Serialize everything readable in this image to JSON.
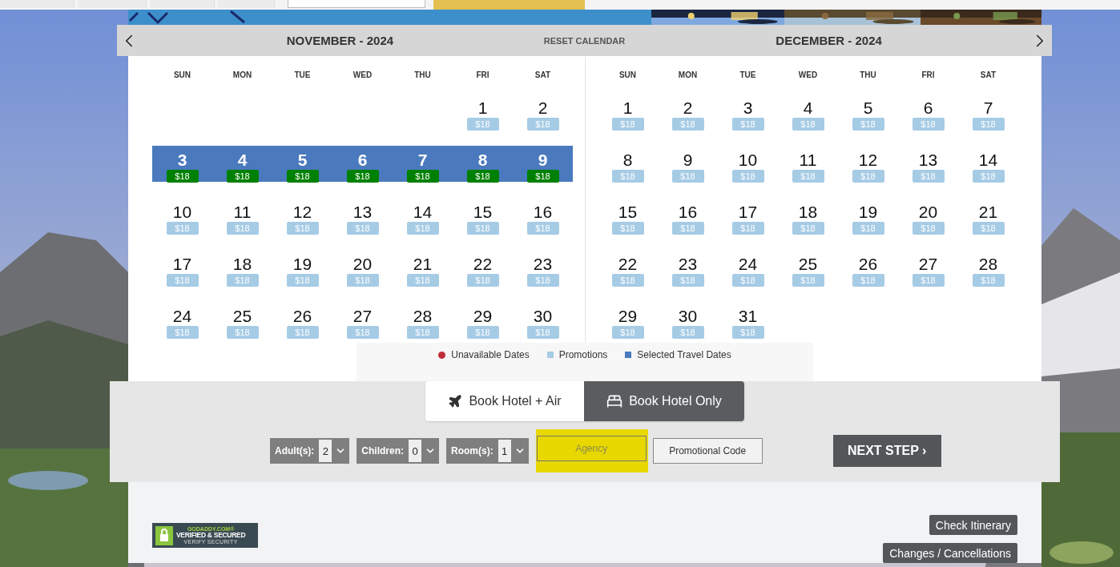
{
  "calendar": {
    "reset_label": "RESET CALENDAR",
    "months": [
      {
        "title": "NOVEMBER - 2024",
        "weekdays": [
          "SUN",
          "MON",
          "TUE",
          "WED",
          "THU",
          "FRI",
          "SAT"
        ],
        "weeks": [
          {
            "kind": "partial",
            "days": [
              {
                "day": "1",
                "price": "$18",
                "selected": false
              },
              {
                "day": "2",
                "price": "$18",
                "selected": false
              }
            ]
          },
          [
            {
              "day": "3",
              "price": "$18",
              "selected": true
            },
            {
              "day": "4",
              "price": "$18",
              "selected": true
            },
            {
              "day": "5",
              "price": "$18",
              "selected": true
            },
            {
              "day": "6",
              "price": "$18",
              "selected": true
            },
            {
              "day": "7",
              "price": "$18",
              "selected": true
            },
            {
              "day": "8",
              "price": "$18",
              "selected": true
            },
            {
              "day": "9",
              "price": "$18",
              "selected": true
            }
          ],
          [
            {
              "day": "10",
              "price": "$18",
              "selected": false
            },
            {
              "day": "11",
              "price": "$18",
              "selected": false
            },
            {
              "day": "12",
              "price": "$18",
              "selected": false
            },
            {
              "day": "13",
              "price": "$18",
              "selected": false
            },
            {
              "day": "14",
              "price": "$18",
              "selected": false
            },
            {
              "day": "15",
              "price": "$18",
              "selected": false
            },
            {
              "day": "16",
              "price": "$18",
              "selected": false
            }
          ],
          [
            {
              "day": "17",
              "price": "$18",
              "selected": false
            },
            {
              "day": "18",
              "price": "$18",
              "selected": false
            },
            {
              "day": "19",
              "price": "$18",
              "selected": false
            },
            {
              "day": "20",
              "price": "$18",
              "selected": false
            },
            {
              "day": "21",
              "price": "$18",
              "selected": false
            },
            {
              "day": "22",
              "price": "$18",
              "selected": false
            },
            {
              "day": "23",
              "price": "$18",
              "selected": false
            }
          ],
          [
            {
              "day": "24",
              "price": "$18",
              "selected": false
            },
            {
              "day": "25",
              "price": "$18",
              "selected": false
            },
            {
              "day": "26",
              "price": "$18",
              "selected": false
            },
            {
              "day": "27",
              "price": "$18",
              "selected": false
            },
            {
              "day": "28",
              "price": "$18",
              "selected": false
            },
            {
              "day": "29",
              "price": "$18",
              "selected": false
            },
            {
              "day": "30",
              "price": "$18",
              "selected": false
            }
          ]
        ]
      },
      {
        "title": "DECEMBER - 2024",
        "weekdays": [
          "SUN",
          "MON",
          "TUE",
          "WED",
          "THU",
          "FRI",
          "SAT"
        ],
        "weeks": [
          [
            {
              "day": "1",
              "price": "$18",
              "selected": false
            },
            {
              "day": "2",
              "price": "$18",
              "selected": false
            },
            {
              "day": "3",
              "price": "$18",
              "selected": false
            },
            {
              "day": "4",
              "price": "$18",
              "selected": false
            },
            {
              "day": "5",
              "price": "$18",
              "selected": false
            },
            {
              "day": "6",
              "price": "$18",
              "selected": false
            },
            {
              "day": "7",
              "price": "$18",
              "selected": false
            }
          ],
          [
            {
              "day": "8",
              "price": "$18",
              "selected": false
            },
            {
              "day": "9",
              "price": "$18",
              "selected": false
            },
            {
              "day": "10",
              "price": "$18",
              "selected": false
            },
            {
              "day": "11",
              "price": "$18",
              "selected": false
            },
            {
              "day": "12",
              "price": "$18",
              "selected": false
            },
            {
              "day": "13",
              "price": "$18",
              "selected": false
            },
            {
              "day": "14",
              "price": "$18",
              "selected": false
            }
          ],
          [
            {
              "day": "15",
              "price": "$18",
              "selected": false
            },
            {
              "day": "16",
              "price": "$18",
              "selected": false
            },
            {
              "day": "17",
              "price": "$18",
              "selected": false
            },
            {
              "day": "18",
              "price": "$18",
              "selected": false
            },
            {
              "day": "19",
              "price": "$18",
              "selected": false
            },
            {
              "day": "20",
              "price": "$18",
              "selected": false
            },
            {
              "day": "21",
              "price": "$18",
              "selected": false
            }
          ],
          [
            {
              "day": "22",
              "price": "$18",
              "selected": false
            },
            {
              "day": "23",
              "price": "$18",
              "selected": false
            },
            {
              "day": "24",
              "price": "$18",
              "selected": false
            },
            {
              "day": "25",
              "price": "$18",
              "selected": false
            },
            {
              "day": "26",
              "price": "$18",
              "selected": false
            },
            {
              "day": "27",
              "price": "$18",
              "selected": false
            },
            {
              "day": "28",
              "price": "$18",
              "selected": false
            }
          ],
          [
            {
              "day": "29",
              "price": "$18",
              "selected": false
            },
            {
              "day": "30",
              "price": "$18",
              "selected": false
            },
            {
              "day": "31",
              "price": "$18",
              "selected": false
            }
          ]
        ]
      }
    ],
    "legend": [
      {
        "label": "Unavailable Dates",
        "kind": "dot",
        "color": "#c0303a"
      },
      {
        "label": "Promotions",
        "kind": "square",
        "color": "#a6cbe5"
      },
      {
        "label": "Selected Travel Dates",
        "kind": "square",
        "color": "#4a7abd"
      }
    ]
  },
  "booking_options": [
    {
      "label": "Book Hotel + Air",
      "kind": "air",
      "selected": false
    },
    {
      "label": "Book Hotel Only",
      "kind": "hotel",
      "selected": true
    }
  ],
  "counts": [
    {
      "label": "Adult(s):",
      "value": "2"
    },
    {
      "label": "Children:",
      "value": "0"
    },
    {
      "label": "Room(s):",
      "value": "1"
    }
  ],
  "agency": {
    "placeholder": "Agency",
    "highlighted": true
  },
  "promo_button": "Promotional Code",
  "next_button": "NEXT STEP ›",
  "footer": {
    "badge": [
      "GODADDY.COM®",
      "VERIFIED & SECURED",
      "VERIFY SECURITY"
    ],
    "buttons": [
      "Check Itinerary",
      "Changes / Cancellations"
    ]
  }
}
